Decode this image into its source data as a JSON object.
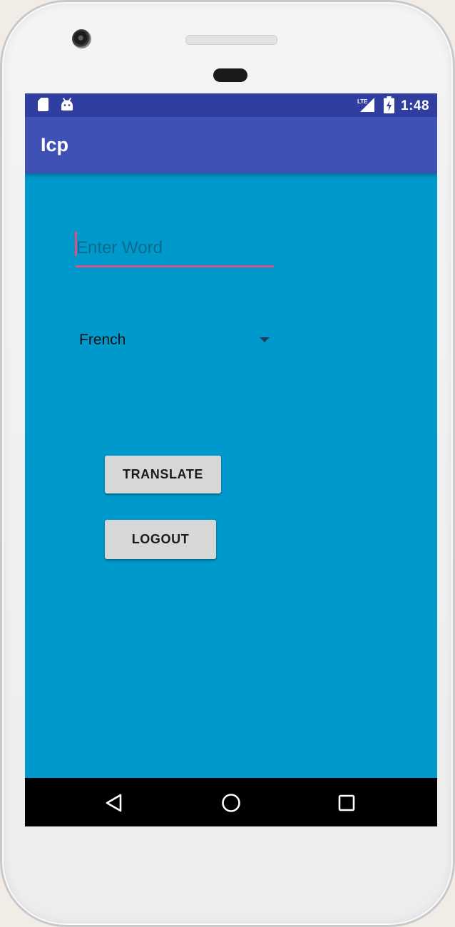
{
  "status_bar": {
    "left_icons": [
      "sd-card-icon",
      "android-icon"
    ],
    "right_icons": [
      "lte-signal-icon",
      "battery-charging-icon"
    ],
    "time": "1:48",
    "network_label": "LTE"
  },
  "app_bar": {
    "title": "Icp"
  },
  "form": {
    "word_input": {
      "value": "",
      "placeholder": "Enter Word"
    },
    "language_spinner": {
      "selected": "French"
    },
    "translate_button": "TRANSLATE",
    "logout_button": "LOGOUT"
  },
  "nav_bar": {
    "buttons": [
      "back-icon",
      "home-icon",
      "recents-icon"
    ]
  },
  "colors": {
    "status_bar": "#303f9f",
    "app_bar": "#3f51b5",
    "background": "#0099cc",
    "accent": "#d9518a",
    "button": "#d6d7d7",
    "nav_bar": "#000000"
  }
}
